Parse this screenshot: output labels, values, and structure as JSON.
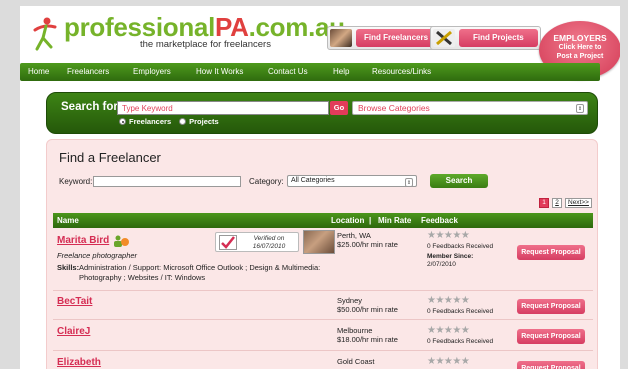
{
  "header": {
    "logo": {
      "pro": "professional",
      "pa": "PA",
      "dom": ".com.au"
    },
    "tagline": "the marketplace for freelancers",
    "find_freelancers_label": "Find Freelancers",
    "find_projects_label": "Find Projects",
    "employers": {
      "line1": "EMPLOYERS",
      "line2": "Click Here to",
      "line3": "Post a Project"
    }
  },
  "nav": {
    "items": [
      "Home",
      "Freelancers",
      "Employers",
      "How It Works",
      "Contact Us",
      "Help",
      "Resources/Links"
    ]
  },
  "search": {
    "label": "Search for",
    "keyword_value": "Type Keyword",
    "go_label": "Go",
    "browse_value": "Browse Categories",
    "radio_freelancers": "Freelancers",
    "radio_projects": "Projects",
    "selected": "Freelancers"
  },
  "find": {
    "title": "Find a Freelancer",
    "keyword_label": "Keyword:",
    "keyword_value": "",
    "category_label": "Category:",
    "category_value": "All Categories",
    "search_label": "Search",
    "pager": {
      "current": "1",
      "next_page": "2",
      "next_label": "Next>>"
    }
  },
  "table": {
    "columns": {
      "name": "Name",
      "location": "Location",
      "sep": "|",
      "min_rate": "Min Rate",
      "feedback": "Feedback"
    },
    "request_label": "Request Proposal",
    "rows": [
      {
        "name": "Marita Bird",
        "subtitle": "Freelance photographer",
        "skills_label": "Skills:",
        "skills_line1": "Administration / Support: Microsoft Office Outlook ; Design & Multimedia:",
        "skills_line2": "Photography ; Websites / IT: Windows",
        "verified_line1": "Verified on",
        "verified_line2": "16/07/2010",
        "location": "Perth, WA",
        "rate": "$25.00/hr min rate",
        "stars": "★★★★★",
        "feedback": "0 Feedbacks Received",
        "member_label": "Member Since:",
        "member_since": "2/07/2010"
      },
      {
        "name": "BecTait",
        "location": "Sydney",
        "rate": "$50.00/hr min rate",
        "stars": "★★★★★",
        "feedback": "0 Feedbacks Received"
      },
      {
        "name": "ClaireJ",
        "location": "Melbourne",
        "rate": "$18.00/hr min rate",
        "stars": "★★★★★",
        "feedback": "0 Feedbacks Received"
      },
      {
        "name": "Elizabeth",
        "location": "Gold Coast",
        "rate": "",
        "stars": "★★★★★",
        "feedback": ""
      }
    ]
  },
  "colors": {
    "accent_green": "#3d8415",
    "accent_pink": "#e23b5a",
    "panel_pink": "#fbe7e7"
  }
}
